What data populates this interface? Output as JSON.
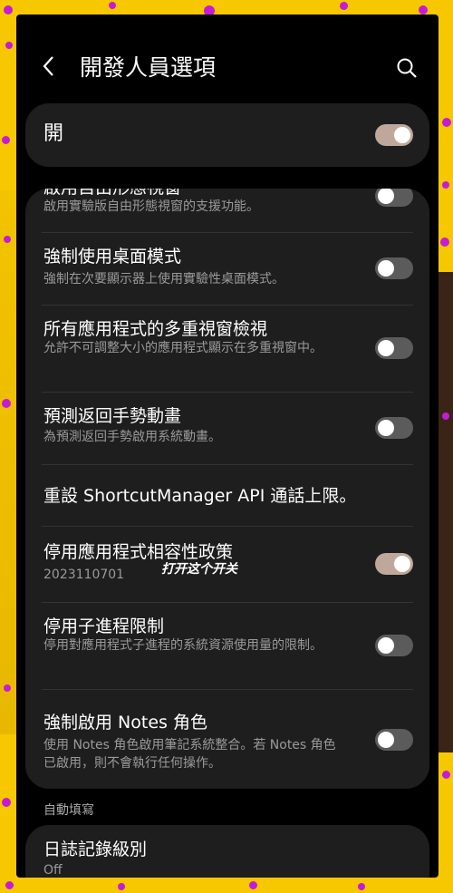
{
  "header": {
    "title": "開發人員選項",
    "back_icon": "chevron-left-icon",
    "search_icon": "search-icon"
  },
  "master_switch": {
    "label": "開",
    "state": "on"
  },
  "settings": [
    {
      "title": "啟用自由形態視窗",
      "subtitle": "啟用實驗版自由形態視窗的支援功能。",
      "toggle": "off"
    },
    {
      "title": "強制使用桌面模式",
      "subtitle": "強制在次要顯示器上使用實驗性桌面模式。",
      "toggle": "off"
    },
    {
      "title": "所有應用程式的多重視窗檢視",
      "subtitle": "允許不可調整大小的應用程式顯示在多重視窗中。",
      "toggle": "off"
    },
    {
      "title": "預測返回手勢動畫",
      "subtitle": "為預測返回手勢啟用系統動畫。",
      "toggle": "off"
    },
    {
      "title": "重設 ShortcutManager API 通話上限。"
    },
    {
      "title": "停用應用程式相容性政策",
      "subtitle": "2023110701",
      "toggle": "on"
    },
    {
      "title": "停用子進程限制",
      "subtitle": "停用對應用程式子進程的系統資源使用量的限制。",
      "toggle": "off"
    },
    {
      "title": "強制啟用 Notes 角色",
      "subtitle": "使用 Notes 角色啟用筆記系統整合。若 Notes 角色已啟用，則不會執行任何操作。",
      "toggle": "off"
    }
  ],
  "annotation": "打开这个开关",
  "section_header": "自動填寫",
  "log_level": {
    "title": "日誌記錄級別",
    "value": "Off"
  },
  "colors": {
    "background": "#f7c800",
    "dots": "#c61bd6",
    "toggle_on": "#bfa89b",
    "toggle_off": "#5b5b5b",
    "card": "#1e1e1e"
  }
}
